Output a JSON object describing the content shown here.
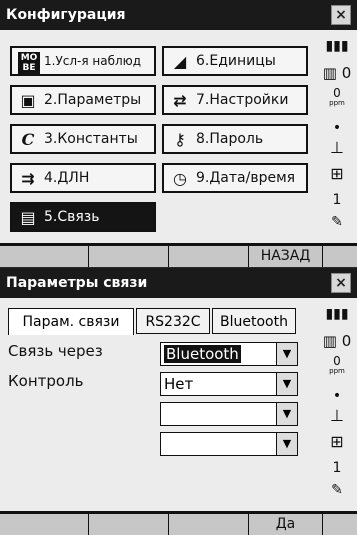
{
  "screen1": {
    "title": "Конфигурация",
    "close_label": "×",
    "menu": [
      {
        "icon": "МО ВЕ",
        "label": "1.Усл-я наблюд"
      },
      {
        "icon": "◢",
        "label": "6.Единицы"
      },
      {
        "icon": "▣",
        "label": "2.Параметры"
      },
      {
        "icon": "⇄",
        "label": "7.Настройки"
      },
      {
        "icon": "C",
        "label": "3.Константы"
      },
      {
        "icon": "⚷",
        "label": "8.Пароль"
      },
      {
        "icon": "⇉",
        "label": "4.ДЛН"
      },
      {
        "icon": "◷",
        "label": "9.Дата/время"
      },
      {
        "icon": "▤",
        "label": "5.Связь"
      }
    ],
    "softkeys": [
      "",
      "",
      "",
      "НАЗАД",
      ""
    ],
    "status": {
      "battery": "▮▮▮",
      "mode_value": "0",
      "ppm_value": "0",
      "ppm_label": "ppm",
      "page_indicator": "1"
    }
  },
  "screen2": {
    "title": "Параметры связи",
    "close_label": "×",
    "tabs": [
      "Парам. связи",
      "RS232C",
      "Bluetooth"
    ],
    "fields": [
      {
        "label": "Связь через",
        "value": "Bluetooth"
      },
      {
        "label": "Контроль",
        "value": "Нет"
      },
      {
        "label": "",
        "value": ""
      },
      {
        "label": "",
        "value": ""
      }
    ],
    "dropdown_arrow": "▼",
    "softkeys": [
      "",
      "",
      "",
      "Да",
      ""
    ],
    "status": {
      "battery": "▮▮▮",
      "mode_value": "0",
      "ppm_value": "0",
      "ppm_label": "ppm",
      "page_indicator": "1"
    }
  }
}
